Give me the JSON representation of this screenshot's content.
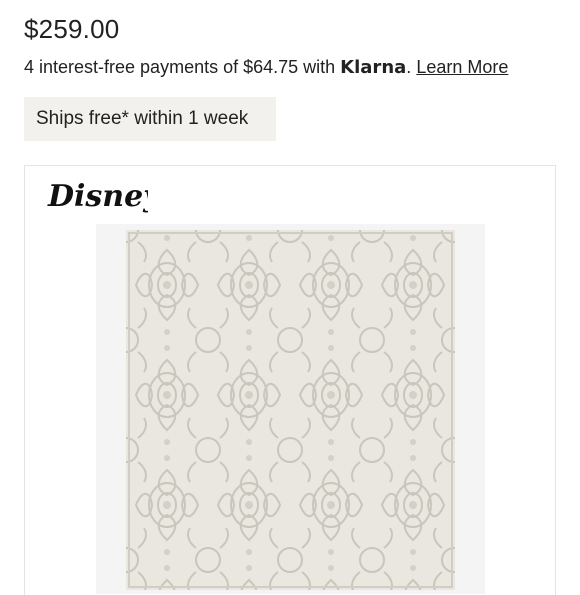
{
  "product": {
    "price": "$259.00",
    "klarna": {
      "prefix": "4 interest-free payments of $64.75 with ",
      "brand": "Klarna",
      "punct": ".",
      "learn_more": "Learn More"
    },
    "shipping_badge": "Ships free* within 1 week",
    "brand_logo_text": "Disney",
    "image": {
      "icon": "damask-rug-image",
      "colors": {
        "background": "#e9e7df",
        "pattern": "#c9c6bb"
      }
    }
  }
}
